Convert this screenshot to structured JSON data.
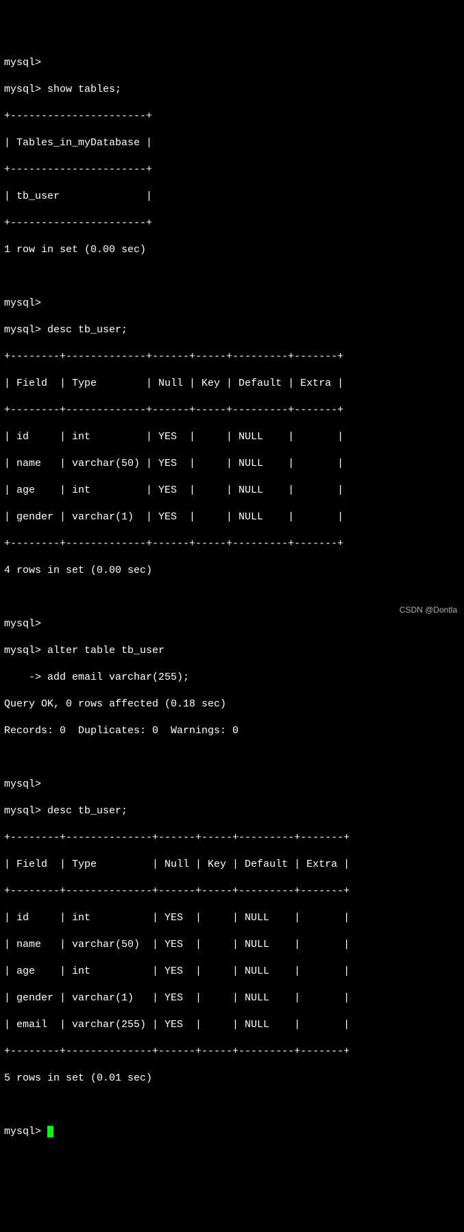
{
  "prompt": "mysql>",
  "cont_prompt": "    ->",
  "cmd_show_tables": "show tables;",
  "cmd_desc_tbuser": "desc tb_user;",
  "cmd_alter_line1": "alter table tb_user",
  "cmd_alter_line2": "add email varchar(255);",
  "tables_box": {
    "border": "+----------------------+",
    "header": "| Tables_in_myDatabase |",
    "row": "| tb_user              |",
    "footer": "1 row in set (0.00 sec)"
  },
  "desc1": {
    "border": "+--------+-------------+------+-----+---------+-------+",
    "header": "| Field  | Type        | Null | Key | Default | Extra |",
    "rows": [
      "| id     | int         | YES  |     | NULL    |       |",
      "| name   | varchar(50) | YES  |     | NULL    |       |",
      "| age    | int         | YES  |     | NULL    |       |",
      "| gender | varchar(1)  | YES  |     | NULL    |       |"
    ],
    "footer": "4 rows in set (0.00 sec)"
  },
  "alter_result": {
    "line1": "Query OK, 0 rows affected (0.18 sec)",
    "line2": "Records: 0  Duplicates: 0  Warnings: 0"
  },
  "desc2": {
    "border": "+--------+--------------+------+-----+---------+-------+",
    "header": "| Field  | Type         | Null | Key | Default | Extra |",
    "rows": [
      "| id     | int          | YES  |     | NULL    |       |",
      "| name   | varchar(50)  | YES  |     | NULL    |       |",
      "| age    | int          | YES  |     | NULL    |       |",
      "| gender | varchar(1)   | YES  |     | NULL    |       |",
      "| email  | varchar(255) | YES  |     | NULL    |       |"
    ],
    "footer": "5 rows in set (0.01 sec)"
  },
  "watermark": "CSDN @Dontla"
}
